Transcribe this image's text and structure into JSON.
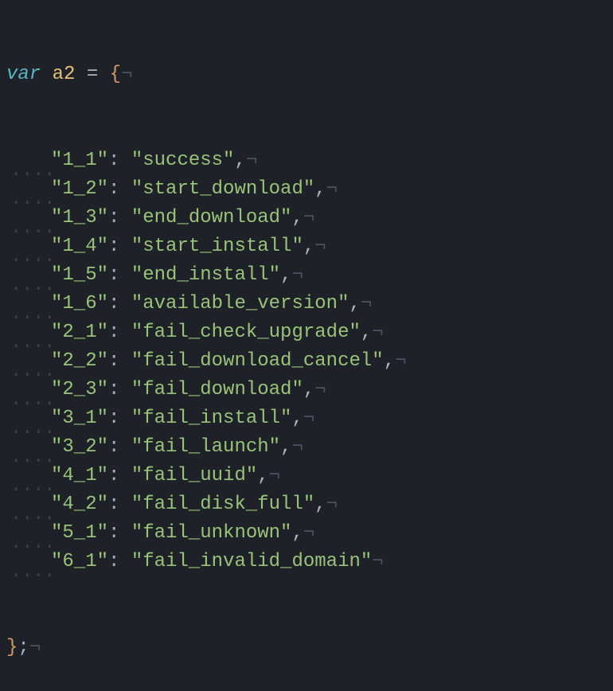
{
  "keyword": "var",
  "identifier": "a2",
  "operator": "=",
  "openBrace": "{",
  "closeBrace": "}",
  "semicolon": ";",
  "comma": ",",
  "colon": ":",
  "eolChar": "¬",
  "entries": [
    {
      "key": "\"1_1\"",
      "value": "\"success\""
    },
    {
      "key": "\"1_2\"",
      "value": "\"start_download\""
    },
    {
      "key": "\"1_3\"",
      "value": "\"end_download\""
    },
    {
      "key": "\"1_4\"",
      "value": "\"start_install\""
    },
    {
      "key": "\"1_5\"",
      "value": "\"end_install\""
    },
    {
      "key": "\"1_6\"",
      "value": "\"available_version\""
    },
    {
      "key": "\"2_1\"",
      "value": "\"fail_check_upgrade\""
    },
    {
      "key": "\"2_2\"",
      "value": "\"fail_download_cancel\""
    },
    {
      "key": "\"2_3\"",
      "value": "\"fail_download\""
    },
    {
      "key": "\"3_1\"",
      "value": "\"fail_install\""
    },
    {
      "key": "\"3_2\"",
      "value": "\"fail_launch\""
    },
    {
      "key": "\"4_1\"",
      "value": "\"fail_uuid\""
    },
    {
      "key": "\"4_2\"",
      "value": "\"fail_disk_full\""
    },
    {
      "key": "\"5_1\"",
      "value": "\"fail_unknown\""
    },
    {
      "key": "\"6_1\"",
      "value": "\"fail_invalid_domain\""
    }
  ]
}
